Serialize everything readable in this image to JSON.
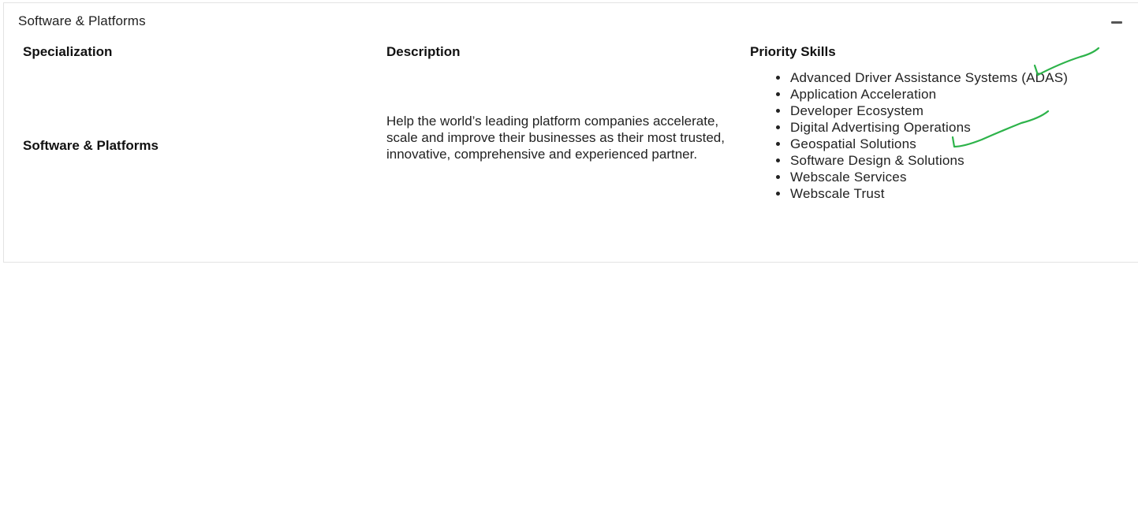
{
  "accordion": {
    "title": "Software & Platforms",
    "collapse_icon": "minus-icon"
  },
  "table": {
    "headers": {
      "specialization": "Specialization",
      "description": "Description",
      "priority_skills": "Priority Skills"
    },
    "row": {
      "specialization": "Software & Platforms",
      "description": "Help the world’s leading platform companies accelerate, scale and improve their businesses as their most trusted, innovative, comprehensive and experienced partner.",
      "skills": [
        "Advanced Driver Assistance Systems (ADAS)",
        "Application Acceleration",
        "Developer Ecosystem",
        "Digital Advertising Operations",
        "Geospatial Solutions",
        "Software Design & Solutions",
        "Webscale Services",
        "Webscale Trust"
      ]
    }
  },
  "annotation_color": "#2db34a"
}
